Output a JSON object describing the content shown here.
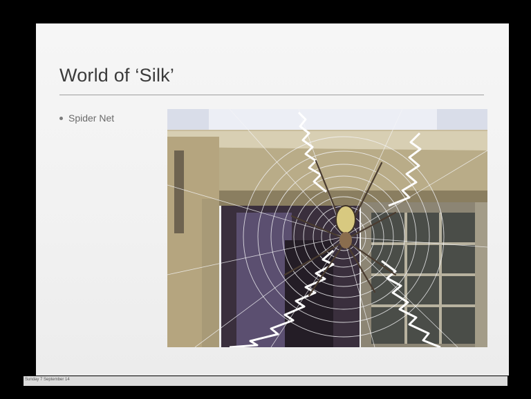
{
  "slide": {
    "title": "World of ‘Silk’",
    "bullets": [
      {
        "text": "Spider Net"
      }
    ],
    "footer": "Sunday 7 September 14"
  },
  "colors": {
    "background": "#000000",
    "slide": "#f3f3f3",
    "title_text": "#3b3b3b",
    "rule": "#9e9e9e"
  },
  "photo": {
    "subject": "spider-on-web-photo"
  }
}
